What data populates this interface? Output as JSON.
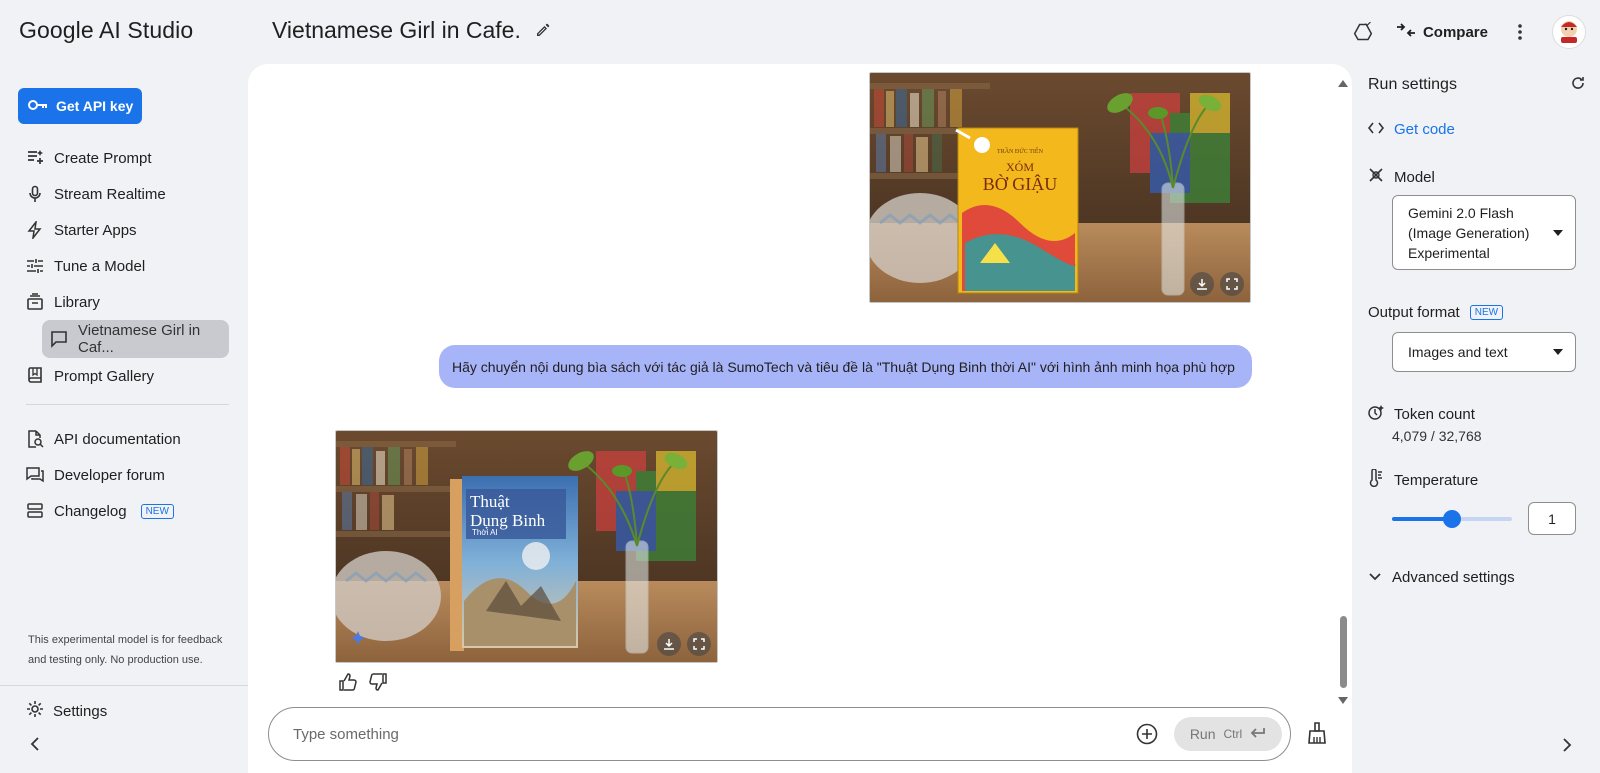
{
  "app": {
    "brand": "Google AI Studio",
    "doc_title": "Vietnamese Girl in Cafe.",
    "compare_label": "Compare"
  },
  "sidebar": {
    "api_key_label": "Get API key",
    "items": [
      {
        "label": "Create Prompt",
        "icon": "create-prompt-icon"
      },
      {
        "label": "Stream Realtime",
        "icon": "microphone-icon"
      },
      {
        "label": "Starter Apps",
        "icon": "bolt-icon"
      },
      {
        "label": "Tune a Model",
        "icon": "sliders-icon"
      },
      {
        "label": "Library",
        "icon": "library-icon"
      }
    ],
    "library_sub_item": "Vietnamese Girl in Caf...",
    "prompt_gallery": "Prompt Gallery",
    "links": [
      {
        "label": "API documentation",
        "icon": "doc-search-icon"
      },
      {
        "label": "Developer forum",
        "icon": "forum-icon"
      },
      {
        "label": "Changelog",
        "icon": "changelog-icon",
        "badge": "NEW"
      }
    ],
    "experimental_note": "This experimental model is for feedback and testing only. No production use.",
    "settings_label": "Settings"
  },
  "chat": {
    "first_image": {
      "author": "TRẦN ĐỨC TIẾN",
      "title_line1": "XÓM",
      "title_line2": "BỜ GIẬU"
    },
    "user_message": "Hãy chuyển nội dung bìa sách với tác giả là SumoTech và tiêu đề là \"Thuật Dụng Binh thời AI\" với hình ảnh minh họa phù hợp",
    "second_image": {
      "title_line1": "Thuật",
      "title_line2": "Dụng Binh",
      "subtitle": "Thời AI"
    },
    "input_placeholder": "Type something",
    "run_label": "Run",
    "run_shortcut": "Ctrl"
  },
  "run_settings": {
    "title": "Run settings",
    "get_code": "Get code",
    "model_label": "Model",
    "model_value_lines": [
      "Gemini 2.0 Flash",
      "(Image Generation)",
      "Experimental"
    ],
    "output_format_label": "Output format",
    "output_format_badge": "NEW",
    "output_format_value": "Images and text",
    "token_count_label": "Token count",
    "token_count_value": "4,079 / 32,768",
    "temperature_label": "Temperature",
    "temperature_value": "1",
    "temperature_fraction": 0.5,
    "advanced_label": "Advanced settings"
  },
  "colors": {
    "accent": "#1a73e8",
    "user_bubble": "#a8b4f8"
  }
}
